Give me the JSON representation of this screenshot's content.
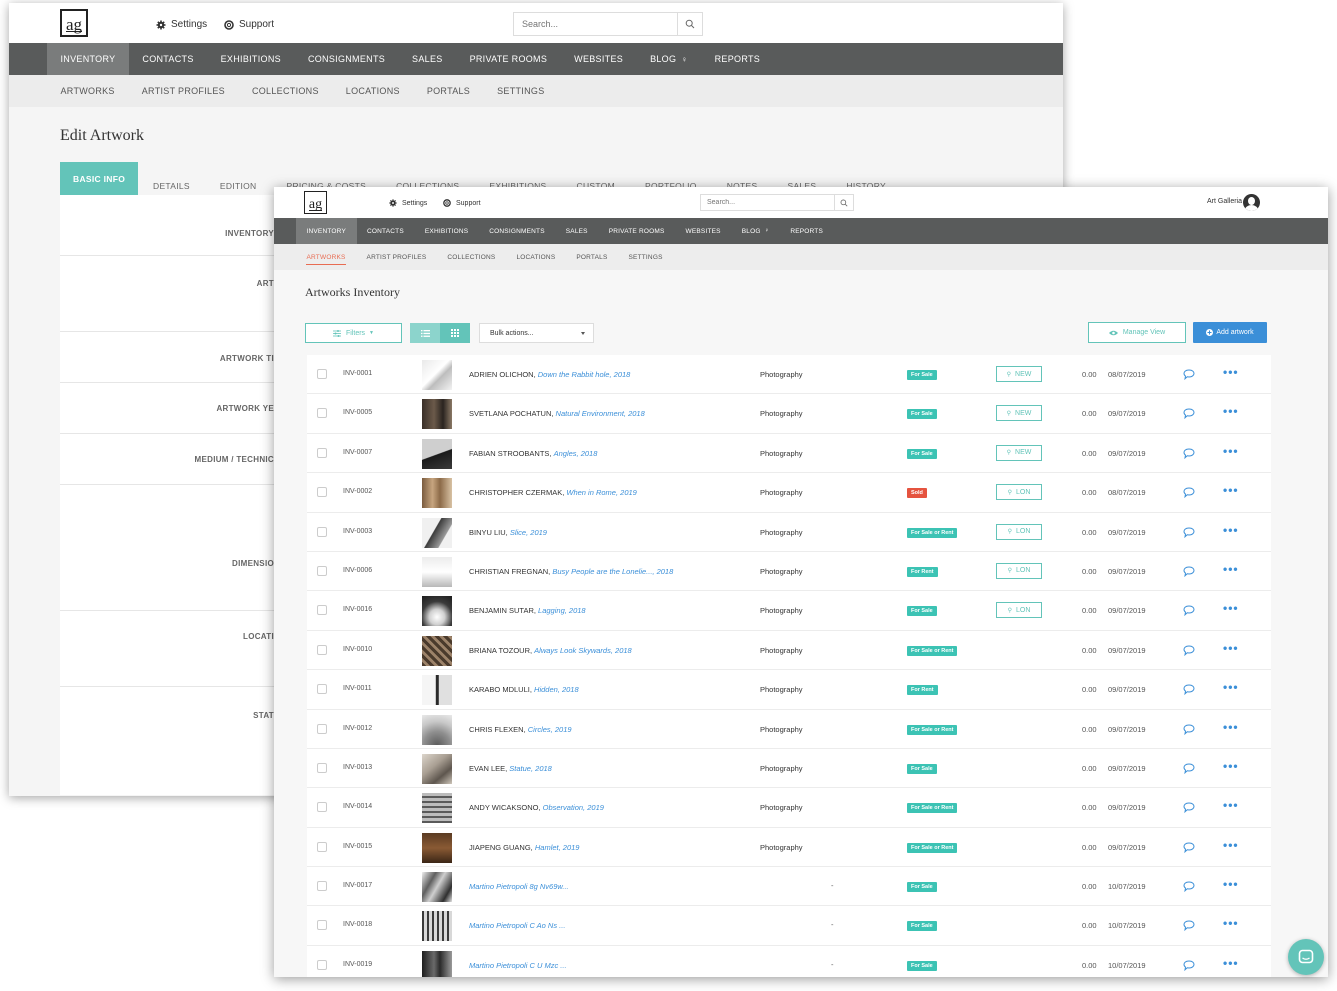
{
  "back": {
    "logo": "ag",
    "settings_label": "Settings",
    "support_label": "Support",
    "search_placeholder": "Search...",
    "nav": [
      "INVENTORY",
      "CONTACTS",
      "EXHIBITIONS",
      "CONSIGNMENTS",
      "SALES",
      "PRIVATE ROOMS",
      "WEBSITES",
      "BLOG",
      "REPORTS"
    ],
    "subnav": [
      "ARTWORKS",
      "ARTIST PROFILES",
      "COLLECTIONS",
      "LOCATIONS",
      "PORTALS",
      "SETTINGS"
    ],
    "page_title": "Edit Artwork",
    "tabs": [
      "BASIC INFO",
      "DETAILS",
      "EDITION",
      "PRICING & COSTS",
      "COLLECTIONS",
      "EXHIBITIONS",
      "CUSTOM",
      "PORTFOLIO",
      "NOTES",
      "SALES",
      "HISTORY"
    ],
    "form_labels": [
      "INVENTORY",
      "ART",
      "ARTWORK TI",
      "ARTWORK YE",
      "MEDIUM / TECHNIC",
      "DIMENSIO",
      "LOCATI",
      "STAT"
    ]
  },
  "front": {
    "logo": "ag",
    "settings_label": "Settings",
    "support_label": "Support",
    "search_placeholder": "Search...",
    "user_name": "Art Galleria",
    "nav": [
      "INVENTORY",
      "CONTACTS",
      "EXHIBITIONS",
      "CONSIGNMENTS",
      "SALES",
      "PRIVATE ROOMS",
      "WEBSITES",
      "BLOG",
      "REPORTS"
    ],
    "subnav": [
      "ARTWORKS",
      "ARTIST PROFILES",
      "COLLECTIONS",
      "LOCATIONS",
      "PORTALS",
      "SETTINGS"
    ],
    "page_title": "Artworks Inventory",
    "filters_label": "Filters",
    "bulk_label": "Bulk actions...",
    "manage_view_label": "Manage View",
    "add_artwork_label": "Add artwork",
    "rows": [
      {
        "id": "INV-0001",
        "artist": "ADRIEN OLICHON, ",
        "work": "Down the Rabbit hole, 2018",
        "medium": "Photography",
        "status": "For Sale",
        "status_color": "#3cc3b4",
        "location": "NEW",
        "price": "0.00",
        "date": "08/07/2019",
        "thumb": "t1"
      },
      {
        "id": "INV-0005",
        "artist": "SVETLANA POCHATUN, ",
        "work": "Natural Environment, 2018",
        "medium": "Photography",
        "status": "For Sale",
        "status_color": "#3cc3b4",
        "location": "NEW",
        "price": "0.00",
        "date": "09/07/2019",
        "thumb": "t2"
      },
      {
        "id": "INV-0007",
        "artist": "FABIAN STROOBANTS, ",
        "work": "Angles, 2018",
        "medium": "Photography",
        "status": "For Sale",
        "status_color": "#3cc3b4",
        "location": "NEW",
        "price": "0.00",
        "date": "09/07/2019",
        "thumb": "t3"
      },
      {
        "id": "INV-0002",
        "artist": "CHRISTOPHER CZERMAK, ",
        "work": "When in Rome, 2019",
        "medium": "Photography",
        "status": "Sold",
        "status_color": "#e5533f",
        "location": "LON",
        "price": "0.00",
        "date": "08/07/2019",
        "thumb": "t4"
      },
      {
        "id": "INV-0003",
        "artist": "BINYU LIU, ",
        "work": "Slice, 2019",
        "medium": "Photography",
        "status": "For Sale or Rent",
        "status_color": "#3cc3b4",
        "location": "LON",
        "price": "0.00",
        "date": "09/07/2019",
        "thumb": "t5"
      },
      {
        "id": "INV-0006",
        "artist": "CHRISTIAN FREGNAN, ",
        "work": "Busy People are the Lonelie..., 2018",
        "medium": "Photography",
        "status": "For Rent",
        "status_color": "#3cc3b4",
        "location": "LON",
        "price": "0.00",
        "date": "09/07/2019",
        "thumb": "t6"
      },
      {
        "id": "INV-0016",
        "artist": "BENJAMIN SUTAR, ",
        "work": "Lagging, 2018",
        "medium": "Photography",
        "status": "For Sale",
        "status_color": "#3cc3b4",
        "location": "LON",
        "price": "0.00",
        "date": "09/07/2019",
        "thumb": "t7"
      },
      {
        "id": "INV-0010",
        "artist": "BRIANA TOZOUR, ",
        "work": "Always Look Skywards, 2018",
        "medium": "Photography",
        "status": "For Sale or Rent",
        "status_color": "#3cc3b4",
        "location": "",
        "price": "0.00",
        "date": "09/07/2019",
        "thumb": "t8"
      },
      {
        "id": "INV-0011",
        "artist": "KARABO MDLULI, ",
        "work": "Hidden, 2018",
        "medium": "Photography",
        "status": "For Rent",
        "status_color": "#3cc3b4",
        "location": "",
        "price": "0.00",
        "date": "09/07/2019",
        "thumb": "t9"
      },
      {
        "id": "INV-0012",
        "artist": "CHRIS FLEXEN, ",
        "work": "Circles, 2019",
        "medium": "Photography",
        "status": "For Sale or Rent",
        "status_color": "#3cc3b4",
        "location": "",
        "price": "0.00",
        "date": "09/07/2019",
        "thumb": "t10"
      },
      {
        "id": "INV-0013",
        "artist": "EVAN LEE, ",
        "work": "Statue, 2018",
        "medium": "Photography",
        "status": "For Sale",
        "status_color": "#3cc3b4",
        "location": "",
        "price": "0.00",
        "date": "09/07/2019",
        "thumb": "t11"
      },
      {
        "id": "INV-0014",
        "artist": "ANDY WICAKSONO, ",
        "work": "Observation, 2019",
        "medium": "Photography",
        "status": "For Sale or Rent",
        "status_color": "#3cc3b4",
        "location": "",
        "price": "0.00",
        "date": "09/07/2019",
        "thumb": "t12"
      },
      {
        "id": "INV-0015",
        "artist": "JIAPENG GUANG, ",
        "work": "Hamlet, 2019",
        "medium": "Photography",
        "status": "For Sale or Rent",
        "status_color": "#3cc3b4",
        "location": "",
        "price": "0.00",
        "date": "09/07/2019",
        "thumb": "t13"
      },
      {
        "id": "INV-0017",
        "artist": "",
        "work": "Martino Pietropoli 8g Nv69w...",
        "medium": "",
        "dash": "-",
        "status": "For Sale",
        "status_color": "#3cc3b4",
        "location": "",
        "price": "0.00",
        "date": "10/07/2019",
        "thumb": "t14"
      },
      {
        "id": "INV-0018",
        "artist": "",
        "work": "Martino Pietropoli C Ao Ns ...",
        "medium": "",
        "dash": "-",
        "status": "For Sale",
        "status_color": "#3cc3b4",
        "location": "",
        "price": "0.00",
        "date": "10/07/2019",
        "thumb": "t15"
      },
      {
        "id": "INV-0019",
        "artist": "",
        "work": "Martino Pietropoli C U Mzc ...",
        "medium": "",
        "dash": "-",
        "status": "For Sale",
        "status_color": "#3cc3b4",
        "location": "",
        "price": "0.00",
        "date": "10/07/2019",
        "thumb": "t16"
      }
    ]
  },
  "colors": {
    "accent": "#63c4b9",
    "link": "#3b8fd8",
    "nav_bg": "#595b5b",
    "sold": "#e5533f"
  }
}
